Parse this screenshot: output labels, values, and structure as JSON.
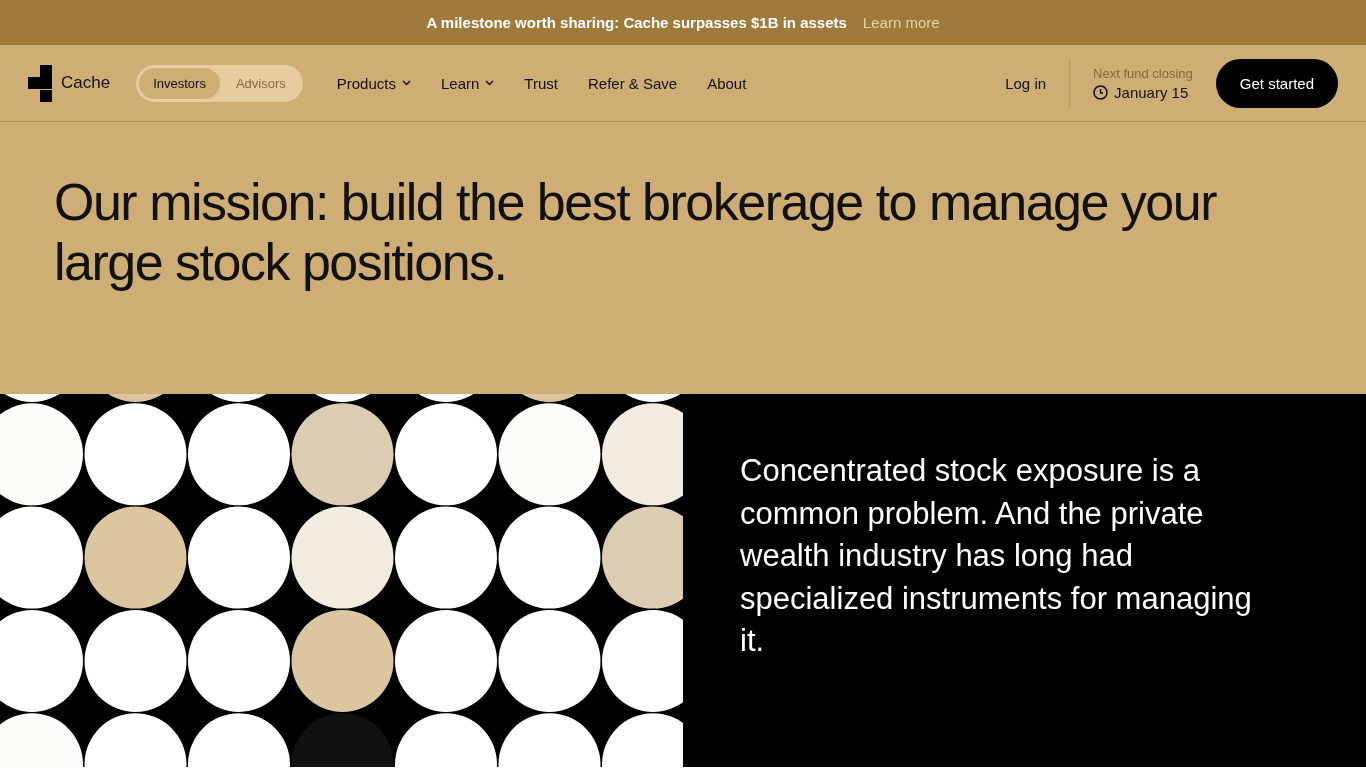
{
  "banner": {
    "text": "A milestone worth sharing: Cache surpasses $1B in assets",
    "link": "Learn more"
  },
  "nav": {
    "logo": "Cache",
    "audience": [
      {
        "label": "Investors",
        "selected": true
      },
      {
        "label": "Advisors",
        "selected": false
      }
    ],
    "links": [
      {
        "label": "Products",
        "kind": "dropdown"
      },
      {
        "label": "Learn",
        "kind": "dropdown"
      },
      {
        "label": "Trust",
        "kind": "plain"
      },
      {
        "label": "Refer & Save",
        "kind": "plain"
      },
      {
        "label": "About",
        "kind": "plain"
      }
    ],
    "login": "Log in",
    "fund_closing": {
      "label": "Next fund closing",
      "date": "January 15"
    },
    "cta": "Get started"
  },
  "hero": {
    "headline": "Our mission: build the best brokerage to manage your large stock positions."
  },
  "feature": {
    "text": "Concentrated stock exposure is a common problem. And the private wealth industry has long had specialized instruments for managing it."
  }
}
